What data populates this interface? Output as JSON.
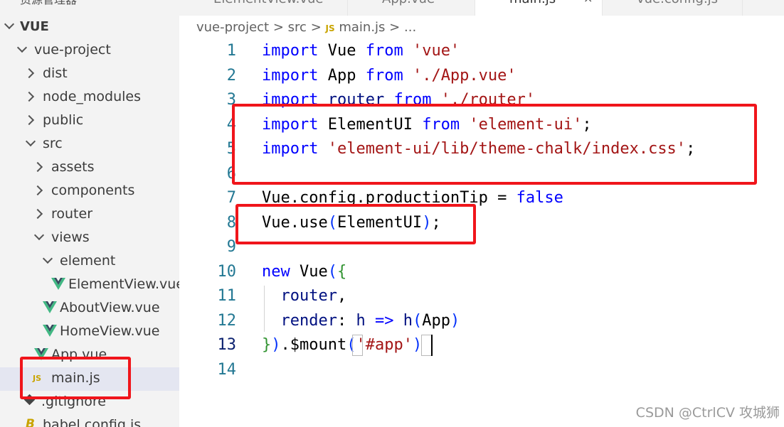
{
  "sidebar": {
    "title": "资源管理器",
    "items": [
      {
        "label": "VUE",
        "depth": 0,
        "type": "root-open"
      },
      {
        "label": "vue-project",
        "depth": 1,
        "type": "folder-open"
      },
      {
        "label": "dist",
        "depth": 2,
        "type": "folder"
      },
      {
        "label": "node_modules",
        "depth": 2,
        "type": "folder"
      },
      {
        "label": "public",
        "depth": 2,
        "type": "folder"
      },
      {
        "label": "src",
        "depth": 2,
        "type": "folder-open"
      },
      {
        "label": "assets",
        "depth": 3,
        "type": "folder"
      },
      {
        "label": "components",
        "depth": 3,
        "type": "folder"
      },
      {
        "label": "router",
        "depth": 3,
        "type": "folder"
      },
      {
        "label": "views",
        "depth": 3,
        "type": "folder-open"
      },
      {
        "label": "element",
        "depth": 4,
        "type": "folder-open"
      },
      {
        "label": "ElementView.vue",
        "depth": 5,
        "type": "vue"
      },
      {
        "label": "AboutView.vue",
        "depth": 4,
        "type": "vue"
      },
      {
        "label": "HomeView.vue",
        "depth": 4,
        "type": "vue"
      },
      {
        "label": "App.vue",
        "depth": 3,
        "type": "vue"
      },
      {
        "label": "main.js",
        "depth": 3,
        "type": "js",
        "selected": true
      },
      {
        "label": ".gitignore",
        "depth": 2,
        "type": "git"
      },
      {
        "label": "babel.config.js",
        "depth": 2,
        "type": "babel"
      }
    ]
  },
  "tabs": [
    {
      "label": "ElementView.vue",
      "icon": "vue-icon"
    },
    {
      "label": "App.vue",
      "icon": "vue-icon"
    },
    {
      "label": "main.js",
      "icon": "js-icon",
      "active": true,
      "close": "×"
    },
    {
      "label": "vue.config.js",
      "icon": "js-icon"
    }
  ],
  "breadcrumb": {
    "parts": [
      "vue-project",
      "src",
      "main.js",
      "..."
    ],
    "separator": ">",
    "js_badge": "JS"
  },
  "editor": {
    "current_line": 13,
    "lines": [
      {
        "n": "1",
        "text": "import Vue from 'vue'"
      },
      {
        "n": "2",
        "text": "import App from './App.vue'"
      },
      {
        "n": "3",
        "text": "import router from './router'"
      },
      {
        "n": "4",
        "text": "import ElementUI from 'element-ui';"
      },
      {
        "n": "5",
        "text": "import 'element-ui/lib/theme-chalk/index.css';"
      },
      {
        "n": "6",
        "text": ""
      },
      {
        "n": "7",
        "text": "Vue.config.productionTip = false"
      },
      {
        "n": "8",
        "text": "Vue.use(ElementUI);"
      },
      {
        "n": "9",
        "text": ""
      },
      {
        "n": "10",
        "text": "new Vue({"
      },
      {
        "n": "11",
        "text": "  router,"
      },
      {
        "n": "12",
        "text": "  render: h => h(App)"
      },
      {
        "n": "13",
        "text": "}).$mount('#app')"
      },
      {
        "n": "14",
        "text": ""
      }
    ]
  },
  "annotation_color": "#f0151b",
  "watermark": "CSDN @CtrlCV 攻城狮"
}
